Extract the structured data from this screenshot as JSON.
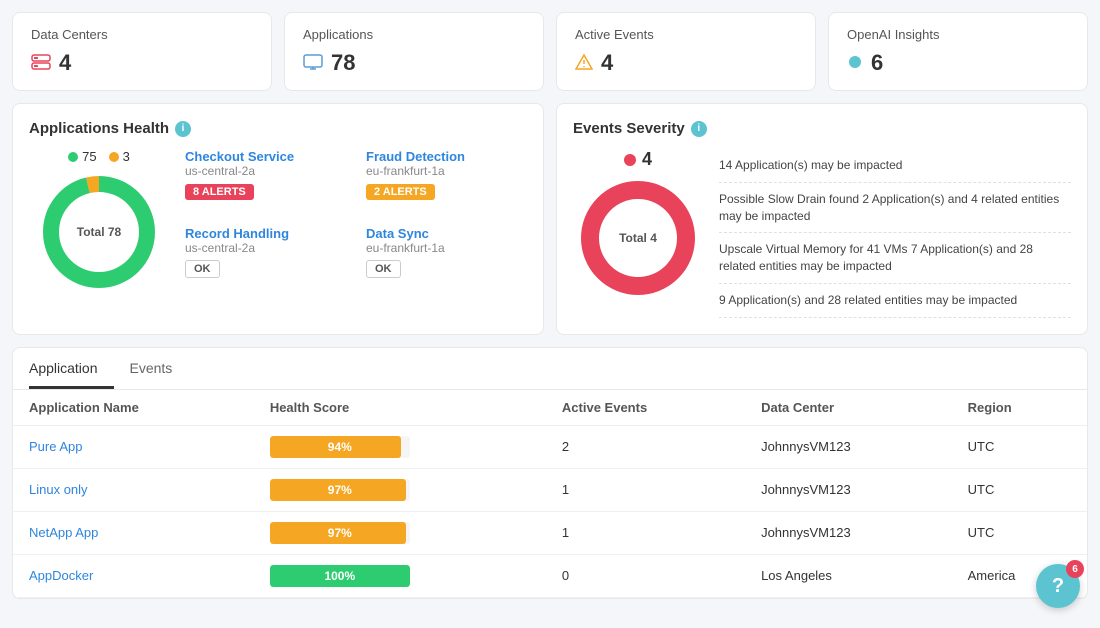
{
  "topCards": [
    {
      "title": "Data Centers",
      "value": "4",
      "iconType": "dc"
    },
    {
      "title": "Applications",
      "value": "78",
      "iconType": "monitor"
    },
    {
      "title": "Active Events",
      "value": "4",
      "iconType": "warning"
    },
    {
      "title": "OpenAI Insights",
      "value": "6",
      "iconType": "bulb"
    }
  ],
  "applicationsHealth": {
    "title": "Applications Health",
    "green": 75,
    "orange": 3,
    "total": 78,
    "totalLabel": "Total 78",
    "apps": [
      {
        "name": "Checkout Service",
        "location": "us-central-2a",
        "badgeText": "8 ALERTS",
        "badgeType": "alert"
      },
      {
        "name": "Fraud Detection",
        "location": "eu-frankfurt-1a",
        "badgeText": "2 ALERTS",
        "badgeType": "orange"
      },
      {
        "name": "Record Handling",
        "location": "us-central-2a",
        "badgeText": "OK",
        "badgeType": "ok"
      },
      {
        "name": "Data Sync",
        "location": "eu-frankfurt-1a",
        "badgeText": "OK",
        "badgeType": "ok"
      }
    ]
  },
  "eventsSeverity": {
    "title": "Events Severity",
    "count": 4,
    "totalLabel": "Total 4",
    "messages": [
      "14 Application(s) may be impacted",
      "Possible Slow Drain found 2 Application(s) and 4 related entities may be impacted",
      "Upscale Virtual Memory for 41 VMs 7 Application(s) and 28 related entities may be impacted",
      "9 Application(s) and 28 related entities may be impacted"
    ]
  },
  "tabs": [
    {
      "label": "Application",
      "active": true
    },
    {
      "label": "Events",
      "active": false
    }
  ],
  "table": {
    "columns": [
      "Application Name",
      "Health Score",
      "Active Events",
      "Data Center",
      "Region"
    ],
    "rows": [
      {
        "name": "Pure App",
        "healthScore": 94,
        "healthColor": "#f5a623",
        "activeEvents": 2,
        "dataCenter": "JohnnysVM123",
        "region": "UTC"
      },
      {
        "name": "Linux only",
        "healthScore": 97,
        "healthColor": "#f5a623",
        "activeEvents": 1,
        "dataCenter": "JohnnysVM123",
        "region": "UTC"
      },
      {
        "name": "NetApp App",
        "healthScore": 97,
        "healthColor": "#f5a623",
        "activeEvents": 1,
        "dataCenter": "JohnnysVM123",
        "region": "UTC"
      },
      {
        "name": "AppDocker",
        "healthScore": 100,
        "healthColor": "#2ecc71",
        "activeEvents": 0,
        "dataCenter": "Los Angeles",
        "region": "America"
      }
    ]
  },
  "helpButton": {
    "badge": "6",
    "label": "?"
  }
}
